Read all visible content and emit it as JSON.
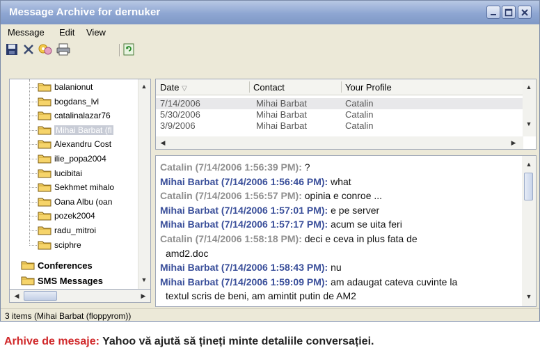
{
  "window": {
    "title": "Message Archive for dernuker"
  },
  "menu": {
    "items": [
      "Message",
      "Edit",
      "View"
    ]
  },
  "toolbar": {
    "icons": [
      "save-icon",
      "delete-icon",
      "find-icon",
      "print-icon",
      "refresh-icon"
    ]
  },
  "tree": {
    "items": [
      {
        "label": "balanionut"
      },
      {
        "label": "bogdans_lvl"
      },
      {
        "label": "catalinalazar76"
      },
      {
        "label": "Mihai Barbat (fl"
      },
      {
        "label": "Alexandru Cost"
      },
      {
        "label": "ilie_popa2004"
      },
      {
        "label": "lucibitai"
      },
      {
        "label": "Sekhmet mihalo"
      },
      {
        "label": "Oana Albu (oan"
      },
      {
        "label": "pozek2004"
      },
      {
        "label": "radu_mitroi"
      },
      {
        "label": "sciphre"
      },
      {
        "label": "Conferences"
      },
      {
        "label": "SMS Messages"
      }
    ]
  },
  "list": {
    "columns": [
      "Date",
      "Contact",
      "Your Profile"
    ],
    "rows": [
      {
        "date": "7/14/2006",
        "contact": "Mihai Barbat",
        "profile": "Catalin"
      },
      {
        "date": "5/30/2006",
        "contact": "Mihai Barbat",
        "profile": "Catalin"
      },
      {
        "date": "3/9/2006",
        "contact": "Mihai Barbat",
        "profile": "Catalin"
      }
    ]
  },
  "messages": [
    {
      "who": "Catalin (7/14/2006 1:56:39 PM):",
      "text": " ?"
    },
    {
      "who": "Mihai Barbat (7/14/2006 1:56:46 PM):",
      "text": " what"
    },
    {
      "who": "Catalin (7/14/2006 1:56:57 PM):",
      "text": " opinia e conroe ..."
    },
    {
      "who": "Mihai Barbat (7/14/2006 1:57:01 PM):",
      "text": " e pe server"
    },
    {
      "who": "Mihai Barbat (7/14/2006 1:57:17 PM):",
      "text": " acum se uita feri"
    },
    {
      "who": "Catalin (7/14/2006 1:58:18 PM):",
      "text": " deci e ceva in plus fata de"
    },
    {
      "who": "",
      "text": "amd2.doc"
    },
    {
      "who": "Mihai Barbat (7/14/2006 1:58:43 PM):",
      "text": " nu"
    },
    {
      "who": "Mihai Barbat (7/14/2006 1:59:09 PM):",
      "text": " am adaugat cateva cuvinte la"
    },
    {
      "who": "",
      "text": "textul scris de beni, am amintit putin de AM2"
    }
  ],
  "status": {
    "text": "3 items (Mihai Barbat (floppyrom))"
  },
  "caption": {
    "label": "Arhive de mesaje:",
    "body": " Yahoo vă ajută să țineți minte detaliile conversației."
  },
  "colors": {
    "title_bar": "#8ea6d2",
    "contact_name": "#3a4f9a",
    "self_name": "#909090",
    "caption_label": "#d0282a"
  }
}
